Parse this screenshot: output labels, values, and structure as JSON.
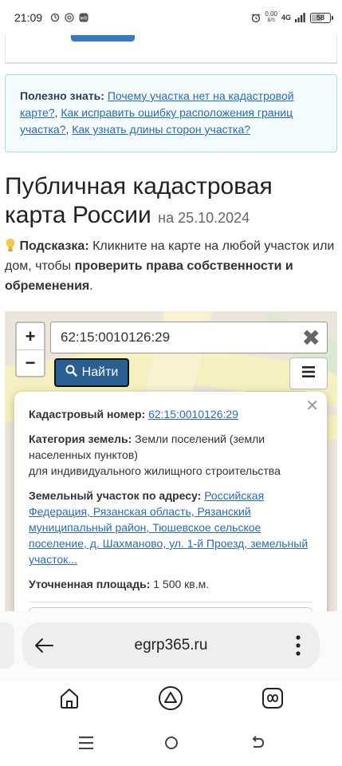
{
  "status_bar": {
    "time": "21:09",
    "net_speed_value": "0,00",
    "net_speed_unit": "B/S",
    "network_type": "4G",
    "battery_level": "58"
  },
  "info_box": {
    "label": "Полезно знать:",
    "link1": "Почему участка нет на кадастровой карте?",
    "sep1": ",",
    "link2": "Как исправить ошибку расположения границ участка?",
    "sep2": ",",
    "link3": "Как узнать длины сторон участка?"
  },
  "page_title": {
    "main": "Публичная кадастровая карта России",
    "date": "на 25.10.2024"
  },
  "hint": {
    "icon": "lightbulb-icon",
    "label": "Подсказка:",
    "text1": "Кликните на карте на любой участок или дом, чтобы",
    "bold": "проверить права собственности и обременения",
    "end": "."
  },
  "map": {
    "zoom_in": "+",
    "zoom_out": "−",
    "search_value": "62:15:0010126:29",
    "clear_symbol": "✖",
    "find_label": "Найти"
  },
  "popup": {
    "close": "✕",
    "cadastral_label": "Кадастровый номер:",
    "cadastral_value": "62:15:0010126:29",
    "category_label": "Категория земель:",
    "category_value": "Земли поселений (земли населенных пунктов)",
    "category_use": "для индивидуального жилищного строительства",
    "address_label": "Земельный участок по адресу:",
    "address_value": "Российская Федерация, Рязанская область, Рязанский муниципальный район, Тюшевское сельское поселение, д. Шахманово, ул. 1-й Проезд, земельный участок...",
    "area_label": "Уточненная площадь:",
    "area_value": "1 500 кв.м."
  },
  "browser": {
    "url": "egrp365.ru"
  },
  "colors": {
    "link": "#2b6cb0",
    "find_button": "#2a5f93",
    "info_border": "#a9dbe6",
    "info_bg": "#f3fbfd"
  }
}
